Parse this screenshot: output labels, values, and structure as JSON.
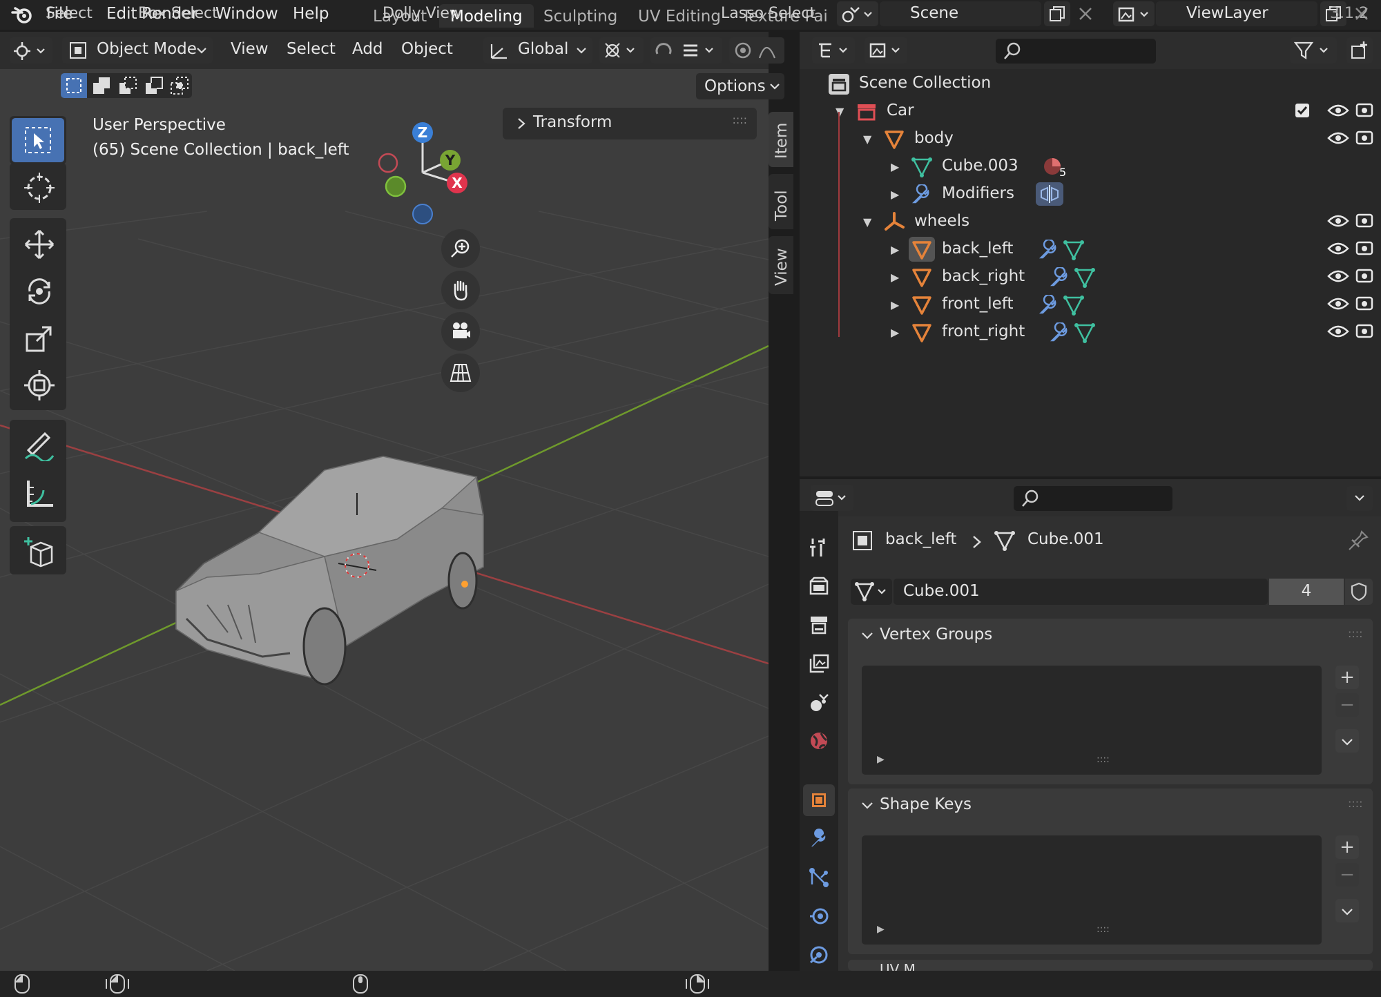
{
  "menu": {
    "file": "File",
    "edit": "Edit",
    "render": "Render",
    "window": "Window",
    "help": "Help"
  },
  "workspaces": [
    "Layout",
    "Modeling",
    "Sculpting",
    "UV Editing",
    "Texture Pai"
  ],
  "active_workspace": "Modeling",
  "scene": {
    "name": "Scene"
  },
  "view_layer": {
    "name": "ViewLayer"
  },
  "viewport_header": {
    "mode": "Object Mode",
    "view": "View",
    "select": "Select",
    "add": "Add",
    "object": "Object",
    "orientation": "Global",
    "options": "Options"
  },
  "viewport": {
    "perspective": "User Perspective",
    "context": "(65) Scene Collection | back_left",
    "transform_panel": "Transform",
    "gizmo": {
      "z": "Z",
      "y": "Y",
      "x": "X"
    }
  },
  "side_tabs": [
    "Item",
    "Tool",
    "View"
  ],
  "outliner": {
    "root": "Scene Collection",
    "rows": [
      {
        "label": "Car"
      },
      {
        "label": "body"
      },
      {
        "label": "Cube.003",
        "badge": "5"
      },
      {
        "label": "Modifiers"
      },
      {
        "label": "wheels"
      },
      {
        "label": "back_left"
      },
      {
        "label": "back_right"
      },
      {
        "label": "front_left"
      },
      {
        "label": "front_right"
      }
    ]
  },
  "properties": {
    "breadcrumb": {
      "object": "back_left",
      "data": "Cube.001"
    },
    "datablock": {
      "name": "Cube.001",
      "users": "4"
    },
    "panels": {
      "vertex_groups": "Vertex Groups",
      "shape_keys": "Shape Keys",
      "uv_maps": "UV M"
    }
  },
  "statusbar": {
    "select": "Select",
    "box_select": "Box Select",
    "dolly_view": "Dolly View",
    "lasso_select": "Lasso Select",
    "version": "3.1.2"
  },
  "colors": {
    "accent": "#4772b3",
    "mesh_orange": "#e5833a",
    "mesh_green": "#3fc0a0",
    "modifier_blue": "#6d9be0"
  }
}
